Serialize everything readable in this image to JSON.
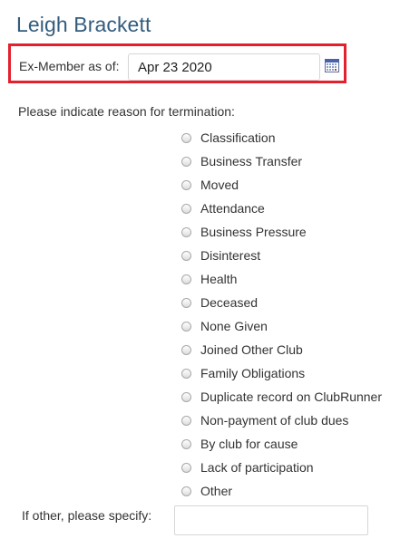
{
  "member": {
    "name": "Leigh Brackett"
  },
  "exmember": {
    "label": "Ex-Member as of:",
    "date_value": "Apr 23 2020",
    "calendar_icon": "calendar-icon",
    "highlight_color": "#e3202e"
  },
  "termination": {
    "prompt": "Please indicate reason for termination:",
    "reasons": [
      {
        "label": "Classification",
        "selected": false
      },
      {
        "label": "Business Transfer",
        "selected": false
      },
      {
        "label": "Moved",
        "selected": false
      },
      {
        "label": "Attendance",
        "selected": false
      },
      {
        "label": "Business Pressure",
        "selected": false
      },
      {
        "label": "Disinterest",
        "selected": false
      },
      {
        "label": "Health",
        "selected": false
      },
      {
        "label": "Deceased",
        "selected": false
      },
      {
        "label": "None Given",
        "selected": false
      },
      {
        "label": "Joined Other Club",
        "selected": false
      },
      {
        "label": "Family Obligations",
        "selected": false
      },
      {
        "label": "Duplicate record on ClubRunner",
        "selected": false
      },
      {
        "label": "Non-payment of club dues",
        "selected": false
      },
      {
        "label": "By club for cause",
        "selected": false
      },
      {
        "label": "Lack of participation",
        "selected": false
      },
      {
        "label": "Other",
        "selected": false
      }
    ],
    "other_label": "If other, please specify:",
    "other_value": ""
  },
  "colors": {
    "title": "#335c7d",
    "text": "#333333"
  }
}
